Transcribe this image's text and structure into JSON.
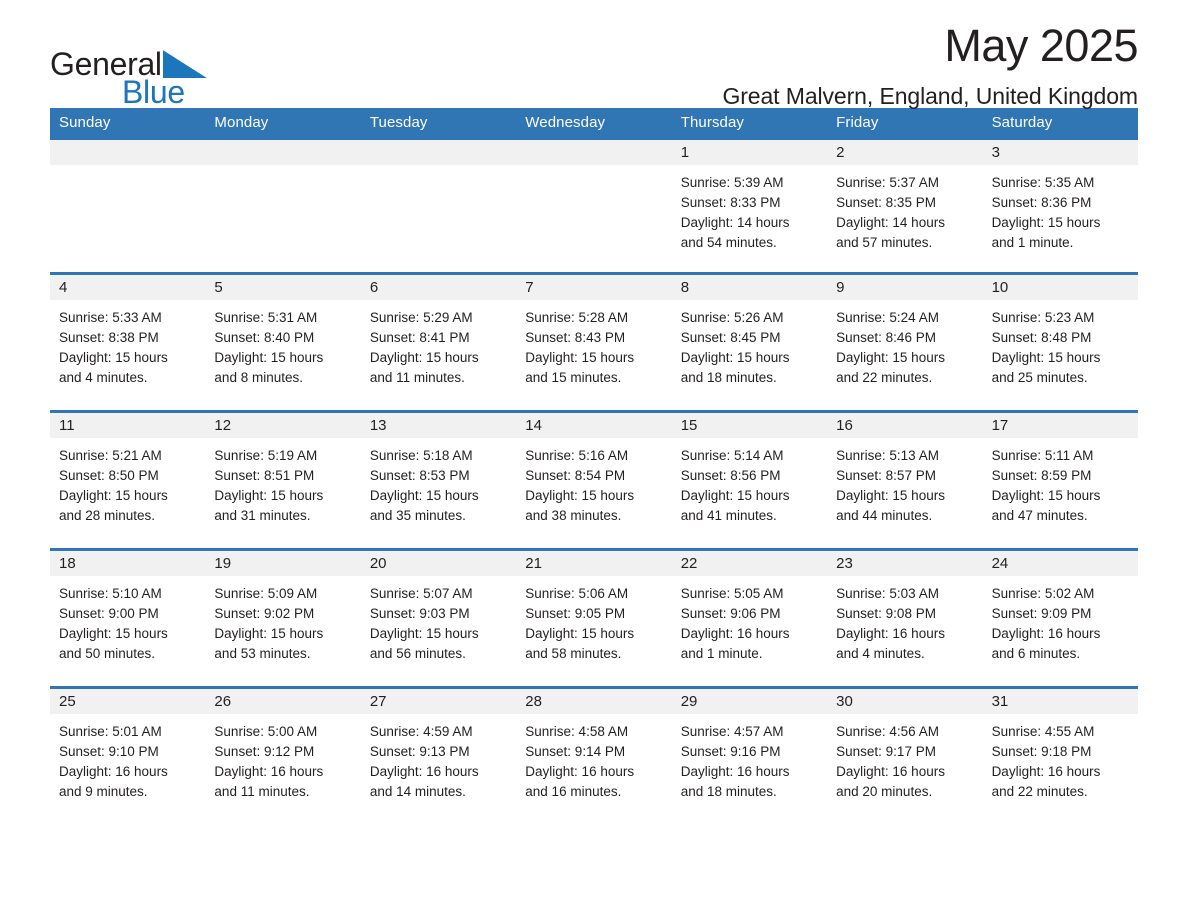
{
  "brand": {
    "name_part1": "General",
    "name_part2": "Blue",
    "logo_icon": "triangle-logo-icon",
    "accent_color": "#1b76bc"
  },
  "header": {
    "title": "May 2025",
    "location": "Great Malvern, England, United Kingdom"
  },
  "calendar": {
    "header_color": "#3076b5",
    "daynum_band_color": "#f1f1f1",
    "weekday_headers": [
      "Sunday",
      "Monday",
      "Tuesday",
      "Wednesday",
      "Thursday",
      "Friday",
      "Saturday"
    ],
    "weeks": [
      [
        {
          "day": "",
          "sunrise": "",
          "sunset": "",
          "daylight1": "",
          "daylight2": "",
          "empty": true
        },
        {
          "day": "",
          "sunrise": "",
          "sunset": "",
          "daylight1": "",
          "daylight2": "",
          "empty": true
        },
        {
          "day": "",
          "sunrise": "",
          "sunset": "",
          "daylight1": "",
          "daylight2": "",
          "empty": true
        },
        {
          "day": "",
          "sunrise": "",
          "sunset": "",
          "daylight1": "",
          "daylight2": "",
          "empty": true
        },
        {
          "day": "1",
          "sunrise": "Sunrise: 5:39 AM",
          "sunset": "Sunset: 8:33 PM",
          "daylight1": "Daylight: 14 hours",
          "daylight2": "and 54 minutes."
        },
        {
          "day": "2",
          "sunrise": "Sunrise: 5:37 AM",
          "sunset": "Sunset: 8:35 PM",
          "daylight1": "Daylight: 14 hours",
          "daylight2": "and 57 minutes."
        },
        {
          "day": "3",
          "sunrise": "Sunrise: 5:35 AM",
          "sunset": "Sunset: 8:36 PM",
          "daylight1": "Daylight: 15 hours",
          "daylight2": "and 1 minute."
        }
      ],
      [
        {
          "day": "4",
          "sunrise": "Sunrise: 5:33 AM",
          "sunset": "Sunset: 8:38 PM",
          "daylight1": "Daylight: 15 hours",
          "daylight2": "and 4 minutes."
        },
        {
          "day": "5",
          "sunrise": "Sunrise: 5:31 AM",
          "sunset": "Sunset: 8:40 PM",
          "daylight1": "Daylight: 15 hours",
          "daylight2": "and 8 minutes."
        },
        {
          "day": "6",
          "sunrise": "Sunrise: 5:29 AM",
          "sunset": "Sunset: 8:41 PM",
          "daylight1": "Daylight: 15 hours",
          "daylight2": "and 11 minutes."
        },
        {
          "day": "7",
          "sunrise": "Sunrise: 5:28 AM",
          "sunset": "Sunset: 8:43 PM",
          "daylight1": "Daylight: 15 hours",
          "daylight2": "and 15 minutes."
        },
        {
          "day": "8",
          "sunrise": "Sunrise: 5:26 AM",
          "sunset": "Sunset: 8:45 PM",
          "daylight1": "Daylight: 15 hours",
          "daylight2": "and 18 minutes."
        },
        {
          "day": "9",
          "sunrise": "Sunrise: 5:24 AM",
          "sunset": "Sunset: 8:46 PM",
          "daylight1": "Daylight: 15 hours",
          "daylight2": "and 22 minutes."
        },
        {
          "day": "10",
          "sunrise": "Sunrise: 5:23 AM",
          "sunset": "Sunset: 8:48 PM",
          "daylight1": "Daylight: 15 hours",
          "daylight2": "and 25 minutes."
        }
      ],
      [
        {
          "day": "11",
          "sunrise": "Sunrise: 5:21 AM",
          "sunset": "Sunset: 8:50 PM",
          "daylight1": "Daylight: 15 hours",
          "daylight2": "and 28 minutes."
        },
        {
          "day": "12",
          "sunrise": "Sunrise: 5:19 AM",
          "sunset": "Sunset: 8:51 PM",
          "daylight1": "Daylight: 15 hours",
          "daylight2": "and 31 minutes."
        },
        {
          "day": "13",
          "sunrise": "Sunrise: 5:18 AM",
          "sunset": "Sunset: 8:53 PM",
          "daylight1": "Daylight: 15 hours",
          "daylight2": "and 35 minutes."
        },
        {
          "day": "14",
          "sunrise": "Sunrise: 5:16 AM",
          "sunset": "Sunset: 8:54 PM",
          "daylight1": "Daylight: 15 hours",
          "daylight2": "and 38 minutes."
        },
        {
          "day": "15",
          "sunrise": "Sunrise: 5:14 AM",
          "sunset": "Sunset: 8:56 PM",
          "daylight1": "Daylight: 15 hours",
          "daylight2": "and 41 minutes."
        },
        {
          "day": "16",
          "sunrise": "Sunrise: 5:13 AM",
          "sunset": "Sunset: 8:57 PM",
          "daylight1": "Daylight: 15 hours",
          "daylight2": "and 44 minutes."
        },
        {
          "day": "17",
          "sunrise": "Sunrise: 5:11 AM",
          "sunset": "Sunset: 8:59 PM",
          "daylight1": "Daylight: 15 hours",
          "daylight2": "and 47 minutes."
        }
      ],
      [
        {
          "day": "18",
          "sunrise": "Sunrise: 5:10 AM",
          "sunset": "Sunset: 9:00 PM",
          "daylight1": "Daylight: 15 hours",
          "daylight2": "and 50 minutes."
        },
        {
          "day": "19",
          "sunrise": "Sunrise: 5:09 AM",
          "sunset": "Sunset: 9:02 PM",
          "daylight1": "Daylight: 15 hours",
          "daylight2": "and 53 minutes."
        },
        {
          "day": "20",
          "sunrise": "Sunrise: 5:07 AM",
          "sunset": "Sunset: 9:03 PM",
          "daylight1": "Daylight: 15 hours",
          "daylight2": "and 56 minutes."
        },
        {
          "day": "21",
          "sunrise": "Sunrise: 5:06 AM",
          "sunset": "Sunset: 9:05 PM",
          "daylight1": "Daylight: 15 hours",
          "daylight2": "and 58 minutes."
        },
        {
          "day": "22",
          "sunrise": "Sunrise: 5:05 AM",
          "sunset": "Sunset: 9:06 PM",
          "daylight1": "Daylight: 16 hours",
          "daylight2": "and 1 minute."
        },
        {
          "day": "23",
          "sunrise": "Sunrise: 5:03 AM",
          "sunset": "Sunset: 9:08 PM",
          "daylight1": "Daylight: 16 hours",
          "daylight2": "and 4 minutes."
        },
        {
          "day": "24",
          "sunrise": "Sunrise: 5:02 AM",
          "sunset": "Sunset: 9:09 PM",
          "daylight1": "Daylight: 16 hours",
          "daylight2": "and 6 minutes."
        }
      ],
      [
        {
          "day": "25",
          "sunrise": "Sunrise: 5:01 AM",
          "sunset": "Sunset: 9:10 PM",
          "daylight1": "Daylight: 16 hours",
          "daylight2": "and 9 minutes."
        },
        {
          "day": "26",
          "sunrise": "Sunrise: 5:00 AM",
          "sunset": "Sunset: 9:12 PM",
          "daylight1": "Daylight: 16 hours",
          "daylight2": "and 11 minutes."
        },
        {
          "day": "27",
          "sunrise": "Sunrise: 4:59 AM",
          "sunset": "Sunset: 9:13 PM",
          "daylight1": "Daylight: 16 hours",
          "daylight2": "and 14 minutes."
        },
        {
          "day": "28",
          "sunrise": "Sunrise: 4:58 AM",
          "sunset": "Sunset: 9:14 PM",
          "daylight1": "Daylight: 16 hours",
          "daylight2": "and 16 minutes."
        },
        {
          "day": "29",
          "sunrise": "Sunrise: 4:57 AM",
          "sunset": "Sunset: 9:16 PM",
          "daylight1": "Daylight: 16 hours",
          "daylight2": "and 18 minutes."
        },
        {
          "day": "30",
          "sunrise": "Sunrise: 4:56 AM",
          "sunset": "Sunset: 9:17 PM",
          "daylight1": "Daylight: 16 hours",
          "daylight2": "and 20 minutes."
        },
        {
          "day": "31",
          "sunrise": "Sunrise: 4:55 AM",
          "sunset": "Sunset: 9:18 PM",
          "daylight1": "Daylight: 16 hours",
          "daylight2": "and 22 minutes."
        }
      ]
    ]
  }
}
